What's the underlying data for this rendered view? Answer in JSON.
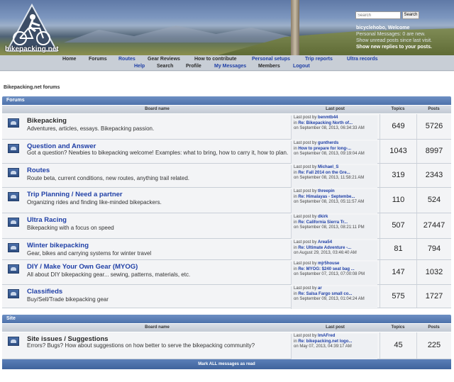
{
  "site": {
    "logo_text": "bikepacking.net"
  },
  "header": {
    "search_placeholder": "Search",
    "search_button": "Search",
    "welcome_user": "bicyclehobo, Welcome",
    "messages": "Personal Messages: 0 are new.",
    "last_visit": "Show unread posts since last visit.",
    "replies": "Show new replies to your posts."
  },
  "nav": {
    "row1": [
      {
        "label": "Home",
        "color": "dark"
      },
      {
        "label": "Forums",
        "color": "dark"
      },
      {
        "label": "Routes",
        "color": "blue"
      },
      {
        "label": "Gear Reviews",
        "color": "dark"
      },
      {
        "label": "How to contribute",
        "color": "dark"
      },
      {
        "label": "Personal setups",
        "color": "blue"
      },
      {
        "label": "Trip reports",
        "color": "blue"
      },
      {
        "label": "Ultra records",
        "color": "blue"
      }
    ],
    "row2": [
      {
        "label": "Help",
        "color": "blue"
      },
      {
        "label": "Search",
        "color": "dark"
      },
      {
        "label": "Profile",
        "color": "dark"
      },
      {
        "label": "My Messages",
        "color": "blue"
      },
      {
        "label": "Members",
        "color": "dark"
      },
      {
        "label": "Logout",
        "color": "blue"
      }
    ]
  },
  "page_title": "Bikepacking.net forums",
  "sections": [
    {
      "title": "Forums",
      "columns": {
        "board": "Board name",
        "last_post": "Last post",
        "topics": "Topics",
        "posts": "Posts"
      },
      "boards": [
        {
          "name": "Bikepacking",
          "name_blue": false,
          "desc": "Adventures, articles, essays. Bikepacking passion.",
          "lp_by": "benmtb44",
          "lp_topic": "Re: Bikepacking North of...",
          "lp_date": "on September 08, 2013, 06:34:33 AM",
          "topics": "649",
          "posts": "5726"
        },
        {
          "name": "Question and Answer",
          "name_blue": true,
          "desc": "Got a question? Newbies to bikepacking welcome! Examples: what to bring, how to carry it, how to plan.",
          "lp_by": "guntherds",
          "lp_topic": "How to prepare for long-...",
          "lp_date": "on September 08, 2013, 09:19:04 AM",
          "topics": "1043",
          "posts": "8997"
        },
        {
          "name": "Routes",
          "name_blue": true,
          "desc": "Route beta, current conditions, new routes, anything trail related.",
          "lp_by": "Michael_S",
          "lp_topic": "Re: Fall 2014 on the Gre...",
          "lp_date": "on September 08, 2013, 11:58:21 AM",
          "topics": "319",
          "posts": "2343"
        },
        {
          "name": "Trip Planning / Need a partner",
          "name_blue": true,
          "desc": "Organizing rides and finding like-minded bikepackers.",
          "lp_by": "threepin",
          "lp_topic": "Re: Himalayas - Septembe...",
          "lp_date": "on September 08, 2013, 05:11:57 AM",
          "topics": "110",
          "posts": "524"
        },
        {
          "name": "Ultra Racing",
          "name_blue": true,
          "desc": "Bikepacking with a focus on speed",
          "lp_by": "dkirk",
          "lp_topic": "Re: California Sierra Tr...",
          "lp_date": "on September 08, 2013, 08:21:11 PM",
          "topics": "507",
          "posts": "27447"
        },
        {
          "name": "Winter bikepacking",
          "name_blue": true,
          "desc": "Gear, bikes and carrying systems for winter travel",
          "lp_by": "Area54",
          "lp_topic": "Re: Ultimate Adventure -...",
          "lp_date": "on August 29, 2013, 03:46:40 AM",
          "topics": "81",
          "posts": "794"
        },
        {
          "name": "DIY / Make Your Own Gear (MYOG)",
          "name_blue": true,
          "desc": "All about DIY bikepacking gear... sewing, patterns, materials, etc.",
          "lp_by": "mjr5house",
          "lp_topic": "Re: MYOG: $240 seat bag ...",
          "lp_date": "on September 07, 2013, 07:00:08 PM",
          "topics": "147",
          "posts": "1032"
        },
        {
          "name": "Classifieds",
          "name_blue": true,
          "desc": "Buy/Sell/Trade bikepacking gear",
          "lp_by": "ar",
          "lp_topic": "Re: Salsa Fargo small co...",
          "lp_date": "on September 09, 2013, 01:04:24 AM",
          "topics": "575",
          "posts": "1727"
        }
      ]
    },
    {
      "title": "Site",
      "columns": {
        "board": "Board name",
        "last_post": "Last post",
        "topics": "Topics",
        "posts": "Posts"
      },
      "boards": [
        {
          "name": "Site issues / Suggestions",
          "name_blue": false,
          "desc": "Errors? Bugs? How about suggestions on how better to serve the bikepacking community?",
          "lp_by": "ImAFred",
          "lp_topic": "Re: bikepacking.net logo...",
          "lp_date": "on May 07, 2013, 04:39:17 AM",
          "topics": "45",
          "posts": "225"
        }
      ]
    }
  ],
  "mark_all": "Mark ALL messages as read",
  "last_post_label": "Last post by",
  "in_label": "in"
}
